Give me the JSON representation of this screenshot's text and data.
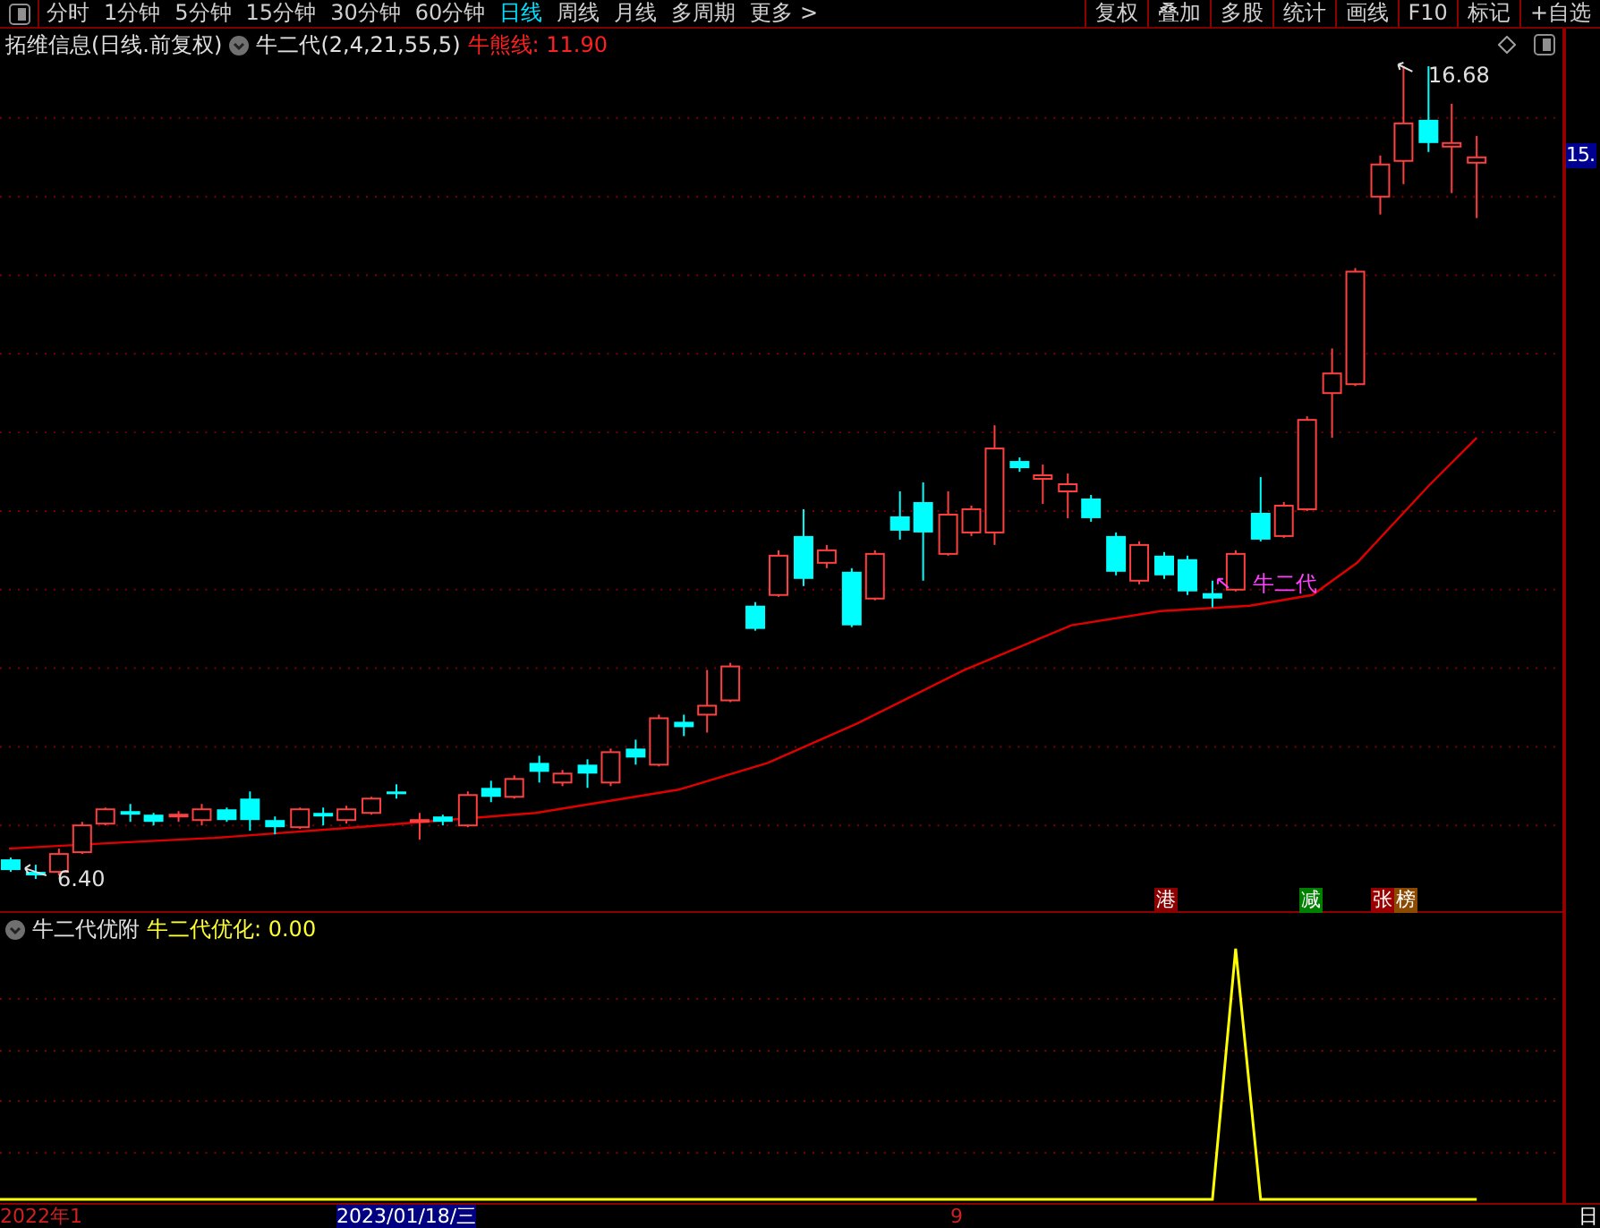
{
  "toolbar": {
    "periods": [
      {
        "label": "分时",
        "selected": false
      },
      {
        "label": "1分钟",
        "selected": false
      },
      {
        "label": "5分钟",
        "selected": false
      },
      {
        "label": "15分钟",
        "selected": false
      },
      {
        "label": "30分钟",
        "selected": false
      },
      {
        "label": "60分钟",
        "selected": false
      },
      {
        "label": "日线",
        "selected": true
      },
      {
        "label": "周线",
        "selected": false
      },
      {
        "label": "月线",
        "selected": false
      },
      {
        "label": "多周期",
        "selected": false
      },
      {
        "label": "更多 >",
        "selected": false
      }
    ],
    "actions": [
      "复权",
      "叠加",
      "多股",
      "统计",
      "画线",
      "F10",
      "标记",
      "+自选"
    ]
  },
  "chart": {
    "title": "拓维信息(日线.前复权)",
    "indicator": "牛二代(2,4,21,55,5)",
    "readout": "牛熊线: 11.90",
    "high_label": "16.68",
    "low_label": "6.40",
    "signal_label": "牛二代",
    "price_tag": "15.",
    "markers": [
      {
        "text": "港",
        "color": "#8b0000"
      },
      {
        "text": "减",
        "color": "#008000"
      },
      {
        "text": "张",
        "color": "#9b0000"
      },
      {
        "text": "榜",
        "color": "#8b4a00"
      }
    ]
  },
  "indicator_panel": {
    "title": "牛二代优附",
    "readout": "牛二代优化: 0.00"
  },
  "date_axis": {
    "start": "2022年1",
    "cursor_date": "2023/01/18/三",
    "mark": "9",
    "corner": "日"
  }
}
